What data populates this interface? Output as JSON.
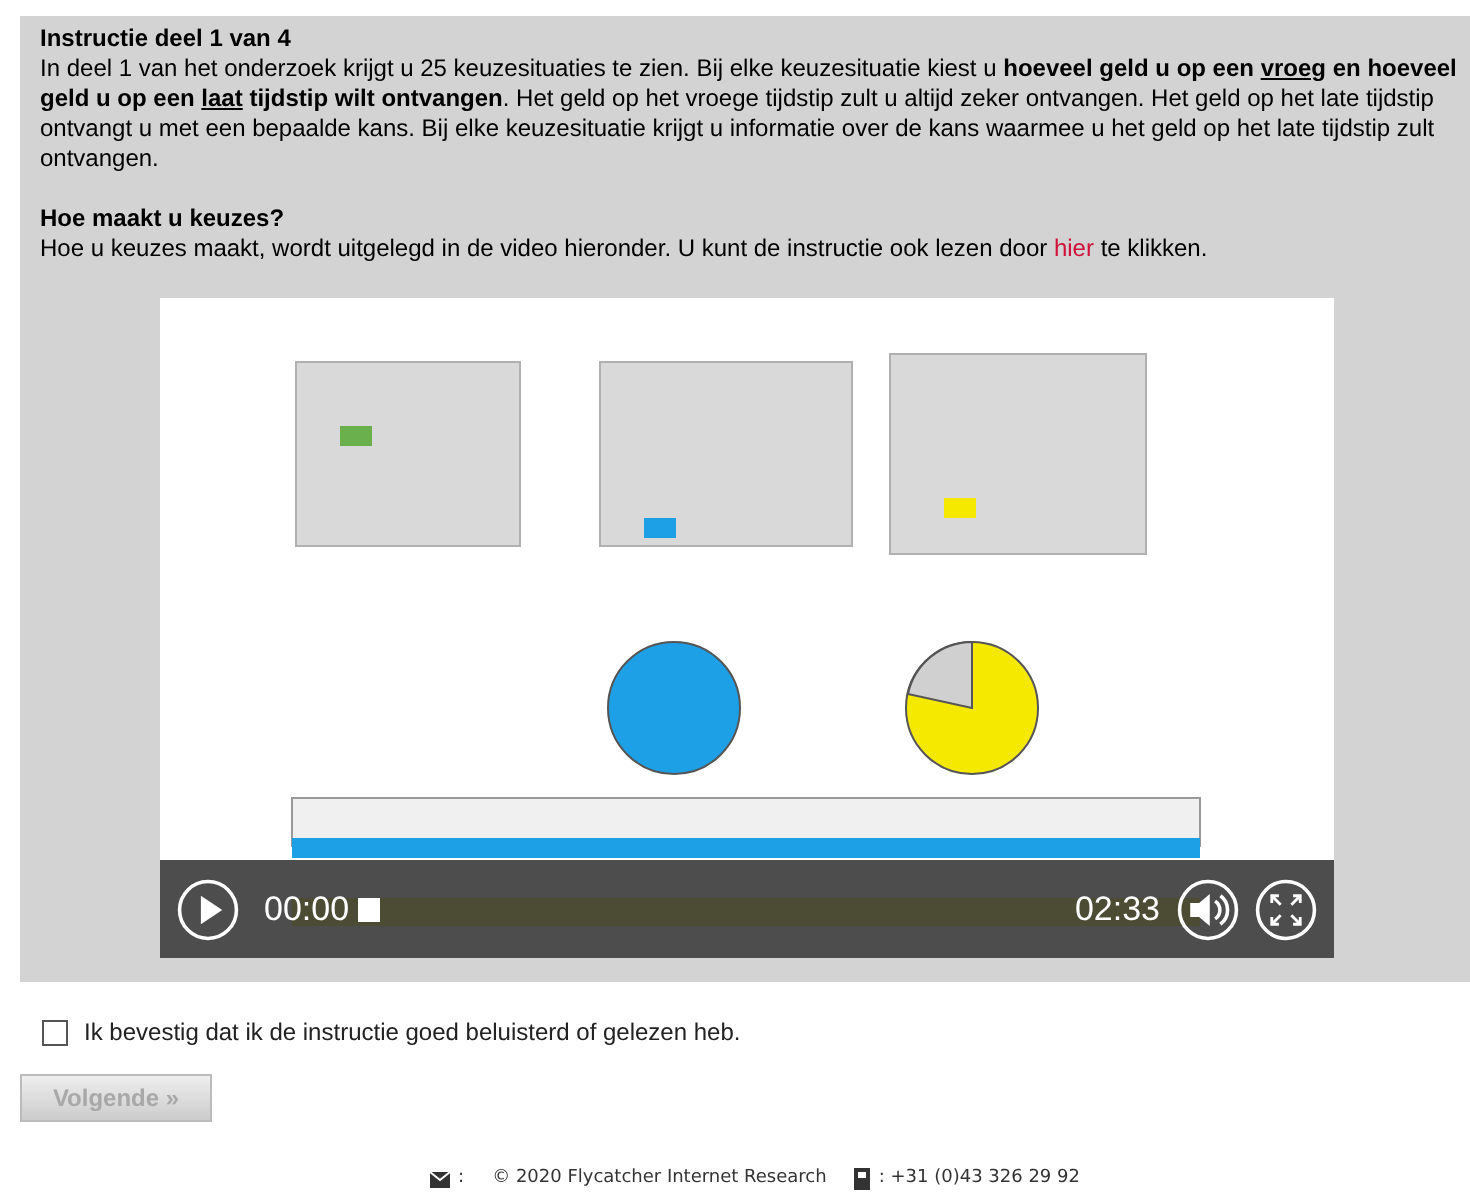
{
  "instruction": {
    "title": "Instructie deel 1 van 4",
    "paragraph": [
      {
        "text": "In deel 1 van het onderzoek krijgt u 25 keuzesituaties te zien. Bij elke keuzesituatie kiest u ",
        "bold": false,
        "underline": false
      },
      {
        "text": "hoeveel geld u op een ",
        "bold": true,
        "underline": false
      },
      {
        "text": "vroeg",
        "bold": true,
        "underline": true
      },
      {
        "text": " en hoeveel geld u op een ",
        "bold": true,
        "underline": false
      },
      {
        "text": "laat",
        "bold": true,
        "underline": true
      },
      {
        "text": " tijdstip wilt ontvangen",
        "bold": true,
        "underline": false
      },
      {
        "text": ". Het geld op het vroege tijdstip zult u altijd zeker ontvangen. Het geld op het late tijdstip ontvangt u met een bepaalde kans. Bij elke keuzesituatie krijgt u informatie over de kans waarmee u het geld op het late tijdstip zult ontvangen.",
        "bold": false,
        "underline": false
      }
    ],
    "subtitle": "Hoe maakt u keuzes?",
    "sentence": [
      {
        "kind": "text",
        "text": "Hoe u keuzes maakt, wordt uitgelegd in de video hieronder. U kunt de instructie ook lezen door "
      },
      {
        "kind": "link",
        "text": "hier"
      },
      {
        "kind": "text",
        "text": " te klikken."
      }
    ]
  },
  "video": {
    "playing": false,
    "current_time": "00:00",
    "progress": {
      "level": 0
    },
    "duration": "02:33",
    "muted": false
  },
  "confirm": {
    "label": "Ik bevestig dat ik de instructie goed beluisterd of gelezen heb.",
    "checked": false
  },
  "next_button": {
    "label": "Volgende »",
    "disabled": true
  },
  "footer": {
    "mail_separator": ":",
    "copyright": "© 2020 Flycatcher Internet Research",
    "phone": ": +31 (0)43 326 29 92"
  }
}
